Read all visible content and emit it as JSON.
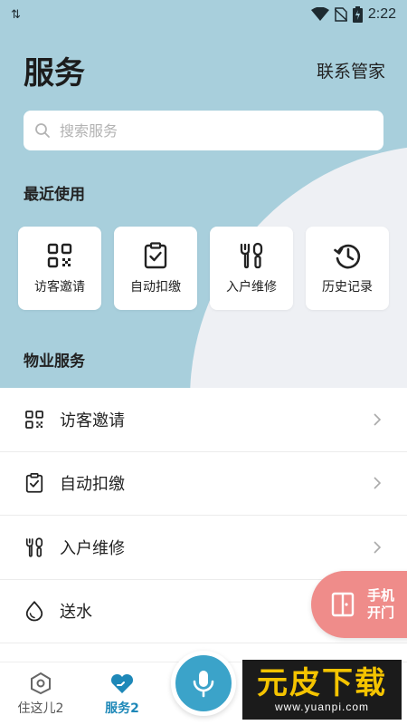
{
  "status_bar": {
    "time": "2:22"
  },
  "header": {
    "title": "服务",
    "contact_link": "联系管家"
  },
  "search": {
    "placeholder": "搜索服务",
    "value": ""
  },
  "recent": {
    "title": "最近使用",
    "items": [
      {
        "label": "访客邀请",
        "icon": "qr-code-icon"
      },
      {
        "label": "自动扣缴",
        "icon": "clipboard-check-icon"
      },
      {
        "label": "入户维修",
        "icon": "repair-tools-icon"
      },
      {
        "label": "历史记录",
        "icon": "history-icon"
      }
    ]
  },
  "property_services": {
    "title": "物业服务",
    "items": [
      {
        "label": "访客邀请",
        "icon": "qr-code-icon"
      },
      {
        "label": "自动扣缴",
        "icon": "clipboard-check-icon"
      },
      {
        "label": "入户维修",
        "icon": "repair-tools-icon"
      },
      {
        "label": "送水",
        "icon": "water-drop-icon"
      }
    ]
  },
  "door_button": {
    "label": "手机开门",
    "color": "#ef8c8a"
  },
  "bottom_nav": {
    "items": [
      {
        "label": "住这儿2",
        "icon": "home-icon",
        "active": false
      },
      {
        "label": "服务2",
        "icon": "heart-hand-icon",
        "active": true
      }
    ],
    "mic_icon": "microphone-icon"
  },
  "watermark": {
    "logo": "元皮下载",
    "url": "www.yuanpi.com"
  },
  "colors": {
    "accent": "#3ba3c9",
    "hero": "#a8cfdc",
    "door": "#ef8c8a"
  }
}
